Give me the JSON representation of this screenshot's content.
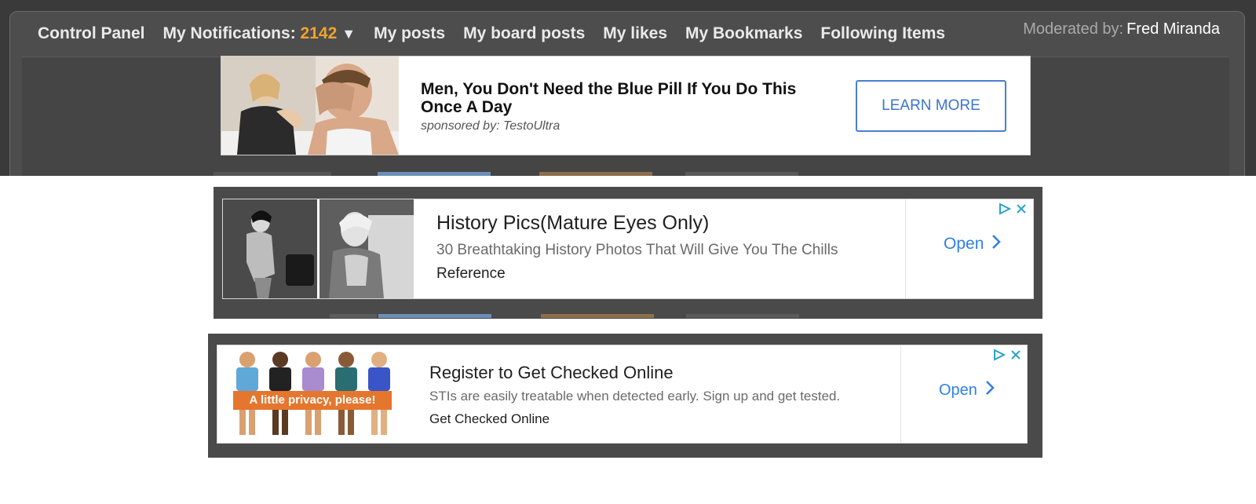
{
  "nav": {
    "items": [
      {
        "label": "Control Panel"
      },
      {
        "label": "My Notifications:",
        "count": "2142",
        "caret": "▼"
      },
      {
        "label": "My posts"
      },
      {
        "label": "My board posts"
      },
      {
        "label": "My likes"
      },
      {
        "label": "My Bookmarks"
      },
      {
        "label": "Following Items"
      }
    ],
    "moderated_label": "Moderated by:",
    "moderator": "Fred Miranda"
  },
  "ad_banner": {
    "headline": "Men, You Don't Need the Blue Pill If You Do This Once A Day",
    "sponsor": "sponsored by: TestoUltra",
    "cta": "LEARN MORE"
  },
  "native_ads": [
    {
      "title": "History Pics(Mature Eyes Only)",
      "description": "30 Breathtaking History Photos That Will Give You The Chills",
      "source": "Reference",
      "cta": "Open"
    },
    {
      "title": "Register to Get Checked Online",
      "description": "STIs are easily treatable when detected early. Sign up and get tested.",
      "source": "Get Checked Online",
      "cta": "Open",
      "image_caption": "A little privacy, please!"
    }
  ],
  "icons": [
    "caret-down-icon",
    "adchoices-icon",
    "close-icon",
    "chevron-right-icon"
  ],
  "colors": {
    "notification_count": "#f0a330",
    "cta_blue": "#2f7fe6",
    "panel_bg": "#4d4d4d"
  }
}
